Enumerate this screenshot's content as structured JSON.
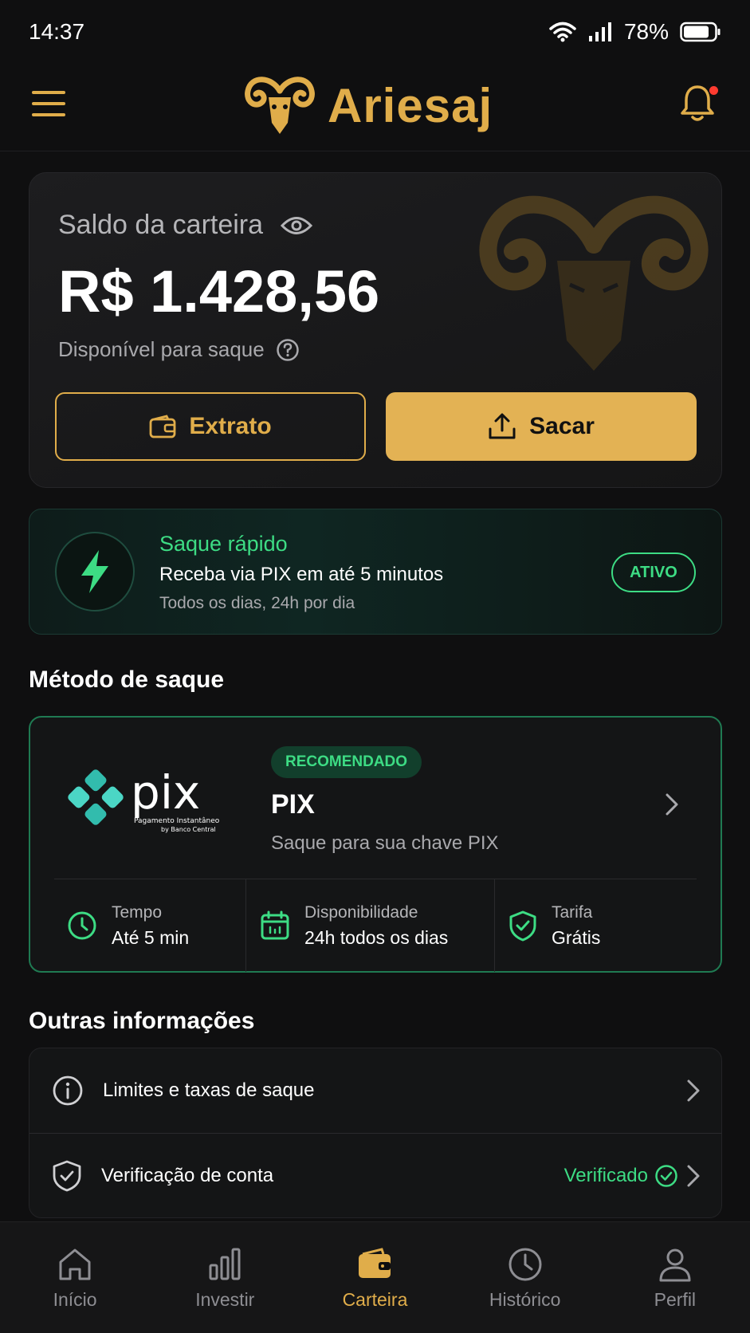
{
  "status_bar": {
    "time": "14:37",
    "battery": "78%"
  },
  "header": {
    "brand": "Ariesaj"
  },
  "balance": {
    "label": "Saldo da carteira",
    "value": "R$ 1.428,56",
    "sublabel": "Disponível para saque",
    "extrato_label": "Extrato",
    "sacar_label": "Sacar"
  },
  "quick": {
    "title": "Saque rápido",
    "line": "Receba via PIX em até 5 minutos",
    "sub": "Todos os dias, 24h por dia",
    "badge": "ATIVO"
  },
  "method": {
    "section_title": "Método de saque",
    "badge": "RECOMENDADO",
    "name": "PIX",
    "desc": "Saque para sua chave PIX",
    "logo_text": "pix",
    "logo_sub1": "Pagamento Instantâneo",
    "logo_sub2": "by Banco Central",
    "stats": [
      {
        "label": "Tempo",
        "value": "Até 5 min"
      },
      {
        "label": "Disponibilidade",
        "value": "24h todos os dias"
      },
      {
        "label": "Tarifa",
        "value": "Grátis"
      }
    ]
  },
  "other": {
    "section_title": "Outras informações",
    "rows": [
      {
        "label": "Limites e taxas de saque"
      },
      {
        "label": "Verificação de conta",
        "status": "Verificado"
      }
    ]
  },
  "nav": {
    "items": [
      {
        "label": "Início",
        "icon": "home-icon"
      },
      {
        "label": "Investir",
        "icon": "chart-icon"
      },
      {
        "label": "Carteira",
        "icon": "wallet-icon",
        "active": true
      },
      {
        "label": "Histórico",
        "icon": "clock-icon"
      },
      {
        "label": "Perfil",
        "icon": "user-icon"
      }
    ]
  },
  "colors": {
    "accent": "#e0ad4a",
    "green": "#3ddc84",
    "background": "#0f0f10"
  }
}
